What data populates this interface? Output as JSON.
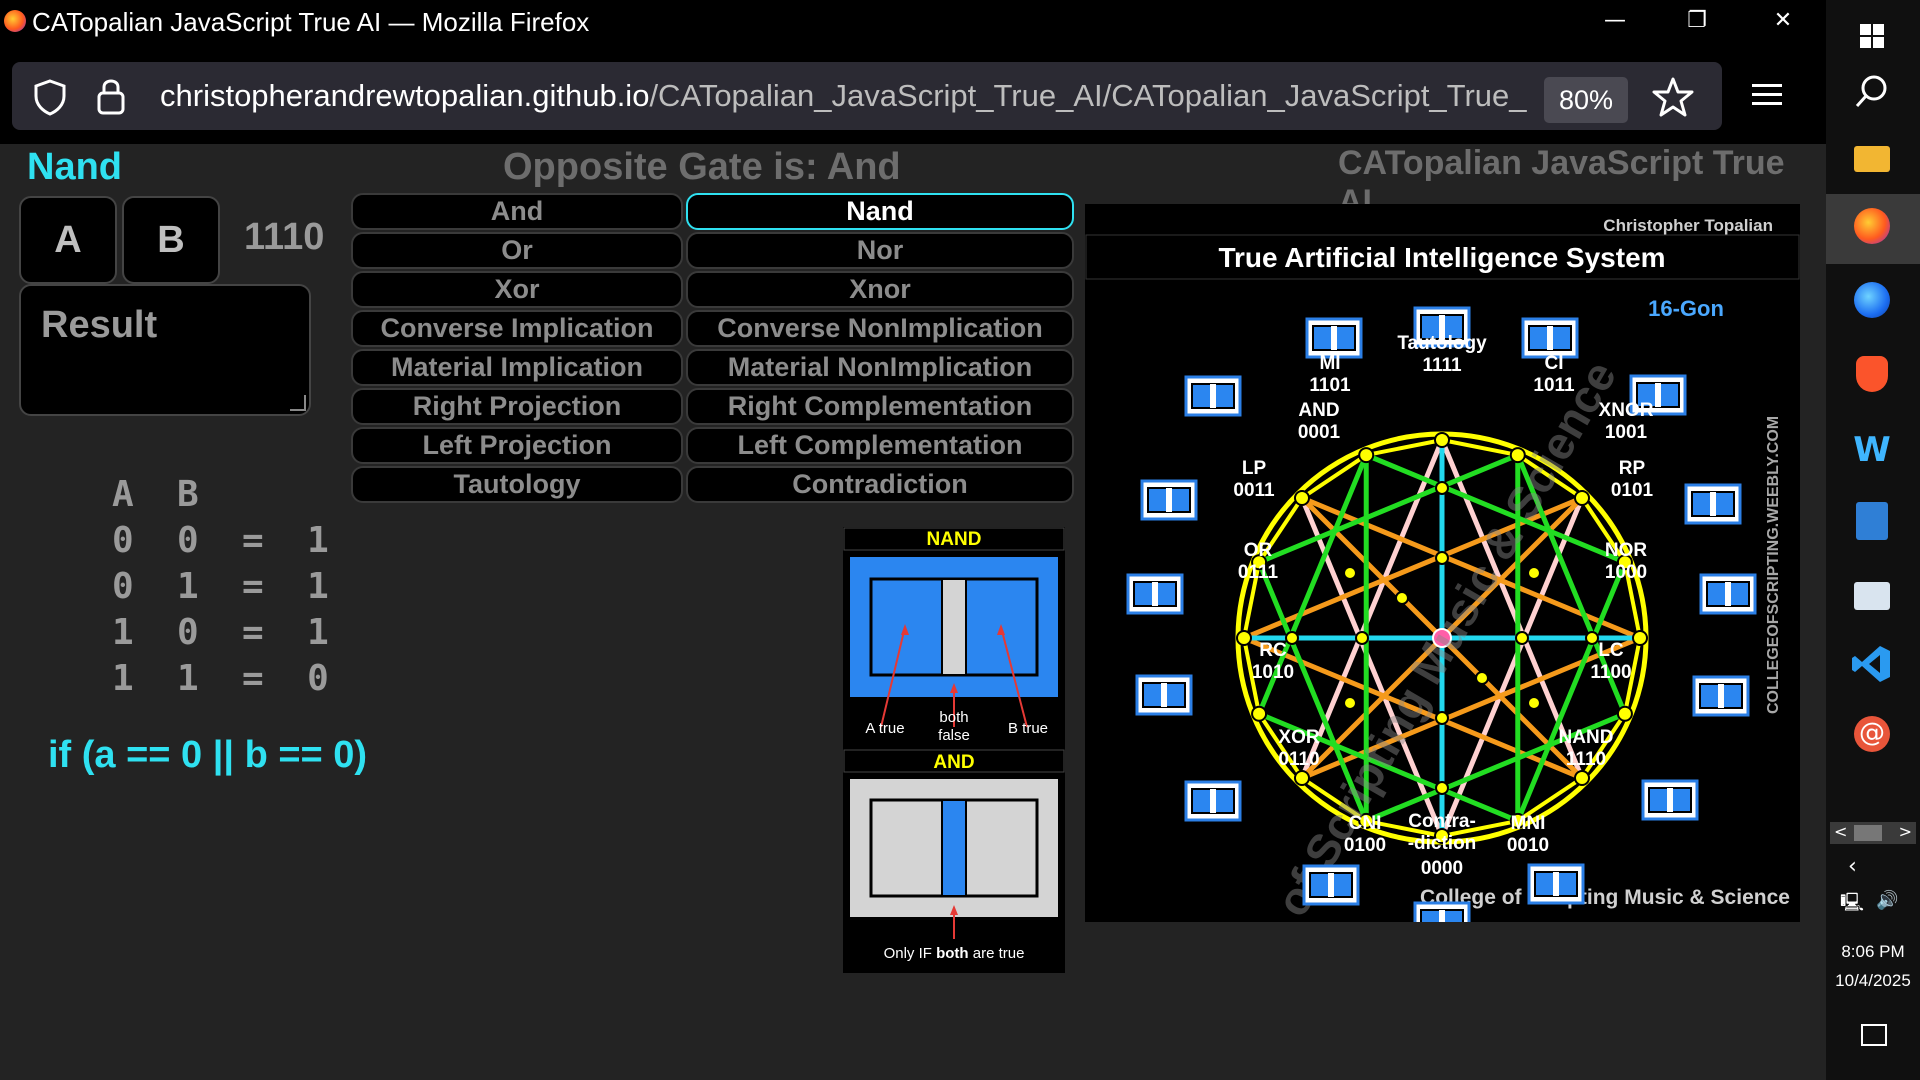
{
  "window": {
    "title": "CATopalian JavaScript True AI — Mozilla Firefox",
    "controls": {
      "minimize": "—",
      "restore": "❐",
      "close": "✕"
    }
  },
  "browser": {
    "url_host": "christopherandrewtopalian.github.io",
    "url_path": "/CATopalian_JavaScript_True_AI/CATopalian_JavaScript_True_",
    "zoom": "80%"
  },
  "page": {
    "gate_name": "Nand",
    "opposite": "Opposite Gate is: And",
    "app_title": "CATopalian JavaScript True AI",
    "input_a": "A",
    "input_b": "B",
    "binary": "1110",
    "result": "Result",
    "truth_table": {
      "header": "A  B",
      "rows": [
        "0  0  =  1",
        "0  1  =  1",
        "1  0  =  1",
        "1  1  =  0"
      ]
    },
    "if_expression": "if (a == 0 || b == 0)",
    "gates_left": [
      "And",
      "Or",
      "Xor",
      "Converse Implication",
      "Material Implication",
      "Right Projection",
      "Left Projection",
      "Tautology"
    ],
    "gates_right": [
      "Nand",
      "Nor",
      "Xnor",
      "Converse NonImplication",
      "Material NonImplication",
      "Right Complementation",
      "Left Complementation",
      "Contradiction"
    ],
    "active_gate": "Nand"
  },
  "reference": {
    "nand_title": "NAND",
    "nand_labels": [
      "A true",
      "both",
      "false",
      "B true"
    ],
    "and_title": "AND",
    "and_caption_prefix": "Only IF ",
    "and_caption_bold": "both",
    "and_caption_suffix": " are true",
    "watermark": "College of Scripting Music and Science"
  },
  "diagram": {
    "author": "Christopher Topalian",
    "title": "True Artificial Intelligence System",
    "tag": "16-Gon",
    "side_text": "COLLEGEOFSCRIPTING.WEEBLY.COM",
    "footer": "College of Scripting Music & Science",
    "watermark": "College of Scripting Music & Science",
    "labels": [
      {
        "name": "Tautology",
        "code": "1111"
      },
      {
        "name": "CI",
        "code": "1011"
      },
      {
        "name": "XNOR",
        "code": "1001"
      },
      {
        "name": "RP",
        "code": "0101"
      },
      {
        "name": "NOR",
        "code": "1000"
      },
      {
        "name": "LC",
        "code": "1100"
      },
      {
        "name": "NAND",
        "code": "1110"
      },
      {
        "name": "MNI",
        "code": "0010"
      },
      {
        "name": "Contra-",
        "code": "-diction"
      },
      {
        "name": "",
        "code": "0000"
      },
      {
        "name": "CNI",
        "code": "0100"
      },
      {
        "name": "XOR",
        "code": "0110"
      },
      {
        "name": "RC",
        "code": "1010"
      },
      {
        "name": "OR",
        "code": "0111"
      },
      {
        "name": "LP",
        "code": "0011"
      },
      {
        "name": "AND",
        "code": "0001"
      },
      {
        "name": "MI",
        "code": "1101"
      }
    ]
  },
  "taskbar": {
    "time": "8:06 PM",
    "date": "10/4/2025"
  },
  "colors": {
    "accent": "#2fe1f1",
    "button_bg": "#000000",
    "page_bg": "#232323",
    "blue": "#2b7fe6",
    "yellow": "#ffff00",
    "green": "#22dd22",
    "orange": "#f59a1b",
    "cyan": "#22d8ee",
    "pink": "#ffd1d1"
  }
}
